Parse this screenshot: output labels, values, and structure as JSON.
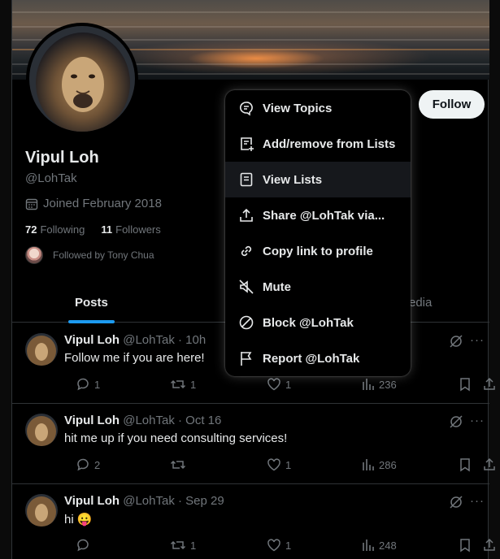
{
  "profile": {
    "name": "Vipul Loh",
    "handle": "@LohTak",
    "joined": "Joined February 2018",
    "following_count": "72",
    "following_label": "Following",
    "followers_count": "11",
    "followers_label": "Followers",
    "followed_by": "Followed by Tony Chua",
    "follow_button": "Follow"
  },
  "tabs": [
    {
      "label": "Posts",
      "active": true
    },
    {
      "label": "edia",
      "active": false
    }
  ],
  "posts": [
    {
      "name": "Vipul Loh",
      "meta": "@LohTak · 10h",
      "text": "Follow me if you are here!",
      "replies": "1",
      "reposts": "1",
      "likes": "1",
      "views": "236"
    },
    {
      "name": "Vipul Loh",
      "meta": "@LohTak · Oct 16",
      "text": "hit me up if you need consulting services!",
      "replies": "2",
      "reposts": "",
      "likes": "1",
      "views": "286"
    },
    {
      "name": "Vipul Loh",
      "meta": "@LohTak · Sep 29",
      "text": "hi 😛",
      "replies": "",
      "reposts": "1",
      "likes": "1",
      "views": "248"
    }
  ],
  "menu": {
    "items": [
      {
        "label": "View Topics",
        "icon": "topics-icon"
      },
      {
        "label": "Add/remove from Lists",
        "icon": "list-add-icon"
      },
      {
        "label": "View Lists",
        "icon": "list-icon",
        "highlighted": true
      },
      {
        "label": "Share @LohTak via...",
        "icon": "share-icon"
      },
      {
        "label": "Copy link to profile",
        "icon": "link-icon"
      },
      {
        "label": "Mute",
        "icon": "mute-icon"
      },
      {
        "label": "Block @LohTak",
        "icon": "block-icon"
      },
      {
        "label": "Report @LohTak",
        "icon": "flag-icon"
      }
    ]
  },
  "colors": {
    "background": "#000000",
    "text": "#e7e9ea",
    "muted": "#71767b",
    "accent": "#1d9bf0",
    "border": "#2f3336"
  }
}
